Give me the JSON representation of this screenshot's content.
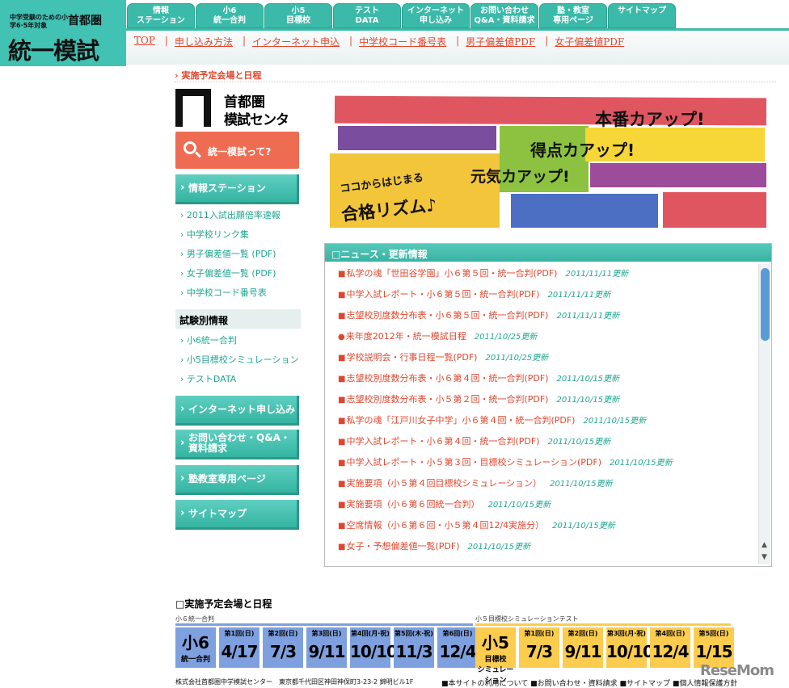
{
  "logo": {
    "sub": "中学受験のための小学6·5年対象",
    "brand": "首都圏",
    "main": "統一模試"
  },
  "tabs": [
    "情報\nステーション",
    "小6\n統一合判",
    "小5\n目標校",
    "テスト\nDATA",
    "インターネット\n申し込み",
    "お問い合わせ\nQ&A・資料請求",
    "塾・教室\n専用ページ",
    "サイトマップ"
  ],
  "subnav": [
    "TOP",
    "申し込み方法",
    "インターネット申込",
    "中学校コード番号表",
    "男子偏差値PDF",
    "女子偏差値PDF"
  ],
  "breadcrumb": "実施予定会場と日程",
  "center_logo": {
    "line1": "首都圏",
    "line2": "模試センター"
  },
  "sidebar": {
    "what_button": "統一模試って?",
    "station_button": "情報ステーション",
    "station_links": [
      "2011入試出願倍率速報",
      "中学校リンク集",
      "男子偏差値一覧 (PDF)",
      "女子偏差値一覧 (PDF)",
      "中学校コード番号表"
    ],
    "exam_heading": "試験別情報",
    "exam_links": [
      "小6統一合判",
      "小5目標校シミュレーション",
      "テストDATA"
    ],
    "internet_button": "インターネット申し込み",
    "inquiry_button": "お問い合わせ・Q&A・\n資料請求",
    "juku_button": "塾教室専用ページ",
    "sitemap_button": "サイトマップ"
  },
  "banner": {
    "t1": "本番カアップ!",
    "t2": "得点カアップ!",
    "t3": "元気カアップ!",
    "t4": "ココからはじまる",
    "t5": "合格リズム♪"
  },
  "news": {
    "title": "ニュース・更新情報",
    "items": [
      {
        "text": "私学の魂「世田谷学園」小６第５回・統一合判(PDF)",
        "date": "2011/11/11更新",
        "bullet": "■"
      },
      {
        "text": "中学入試レポート・小６第５回・統一合判(PDF)",
        "date": "2011/11/11更新",
        "bullet": "■"
      },
      {
        "text": "志望校別度数分布表・小６第５回・統一合判(PDF)",
        "date": "2011/11/11更新",
        "bullet": "■"
      },
      {
        "text": "来年度2012年・統一模試日程",
        "date": "2011/10/25更新",
        "bullet": "●"
      },
      {
        "text": "学校説明会・行事日程一覧(PDF)",
        "date": "2011/10/25更新",
        "bullet": "■"
      },
      {
        "text": "志望校別度数分布表・小６第４回・統一合判(PDF)",
        "date": "2011/10/15更新",
        "bullet": "■"
      },
      {
        "text": "志望校別度数分布表・小５第２回・統一合判(PDF)",
        "date": "2011/10/15更新",
        "bullet": "■"
      },
      {
        "text": "私学の魂「江戸川女子中学」小６第４回・統一合判(PDF)",
        "date": "2011/10/15更新",
        "bullet": "■"
      },
      {
        "text": "中学入試レポート・小６第４回・統一合判(PDF)",
        "date": "2011/10/15更新",
        "bullet": "■"
      },
      {
        "text": "中学入試レポート・小５第３回・目標校シミュレーション(PDF)",
        "date": "2011/10/15更新",
        "bullet": "■"
      },
      {
        "text": "実施要項（小５第４回目標校シミュレーション）",
        "date": "2011/10/15更新",
        "bullet": "■"
      },
      {
        "text": "実施要項（小６第６回統一合判）",
        "date": "2011/10/15更新",
        "bullet": "■"
      },
      {
        "text": "空席情報（小６第６回・小５第４回12/4実施分）",
        "date": "2011/10/15更新",
        "bullet": "■"
      },
      {
        "text": "女子・予想偏差値一覧(PDF)",
        "date": "2011/10/15更新",
        "bullet": "■"
      }
    ]
  },
  "schedule": {
    "title": "□実施予定会場と日程",
    "g6_label": "小６統一合判",
    "g5_label": "小５目標校シミュレーションテスト",
    "g6": {
      "name": "小6",
      "sub": "統一合判",
      "rounds": [
        [
          "第1回(日)",
          "4/17"
        ],
        [
          "第2回(日)",
          "7/3"
        ],
        [
          "第3回(日)",
          "9/11"
        ],
        [
          "第4回(月·祝)",
          "10/10"
        ],
        [
          "第5回(木·祝)",
          "11/3"
        ],
        [
          "第6回(日)",
          "12/4"
        ]
      ]
    },
    "g5": {
      "name": "小5",
      "sub": "目標校\nシミュレーション",
      "rounds": [
        [
          "第1回(日)",
          "7/3"
        ],
        [
          "第2回(日)",
          "9/11"
        ],
        [
          "第3回(月·祝)",
          "10/10"
        ],
        [
          "第4回(日)",
          "12/4"
        ],
        [
          "第5回(日)",
          "1/15"
        ]
      ]
    }
  },
  "footer": {
    "left": "株式会社首都圏中学模試センター　東京都千代田区神田神保町3-23-2 錦明ビル1F",
    "right": "■本サイトの利用について ■お問い合わせ・資料請求 ■サイトマップ ■個人情報保護方針"
  },
  "watermark": "ReseMom"
}
